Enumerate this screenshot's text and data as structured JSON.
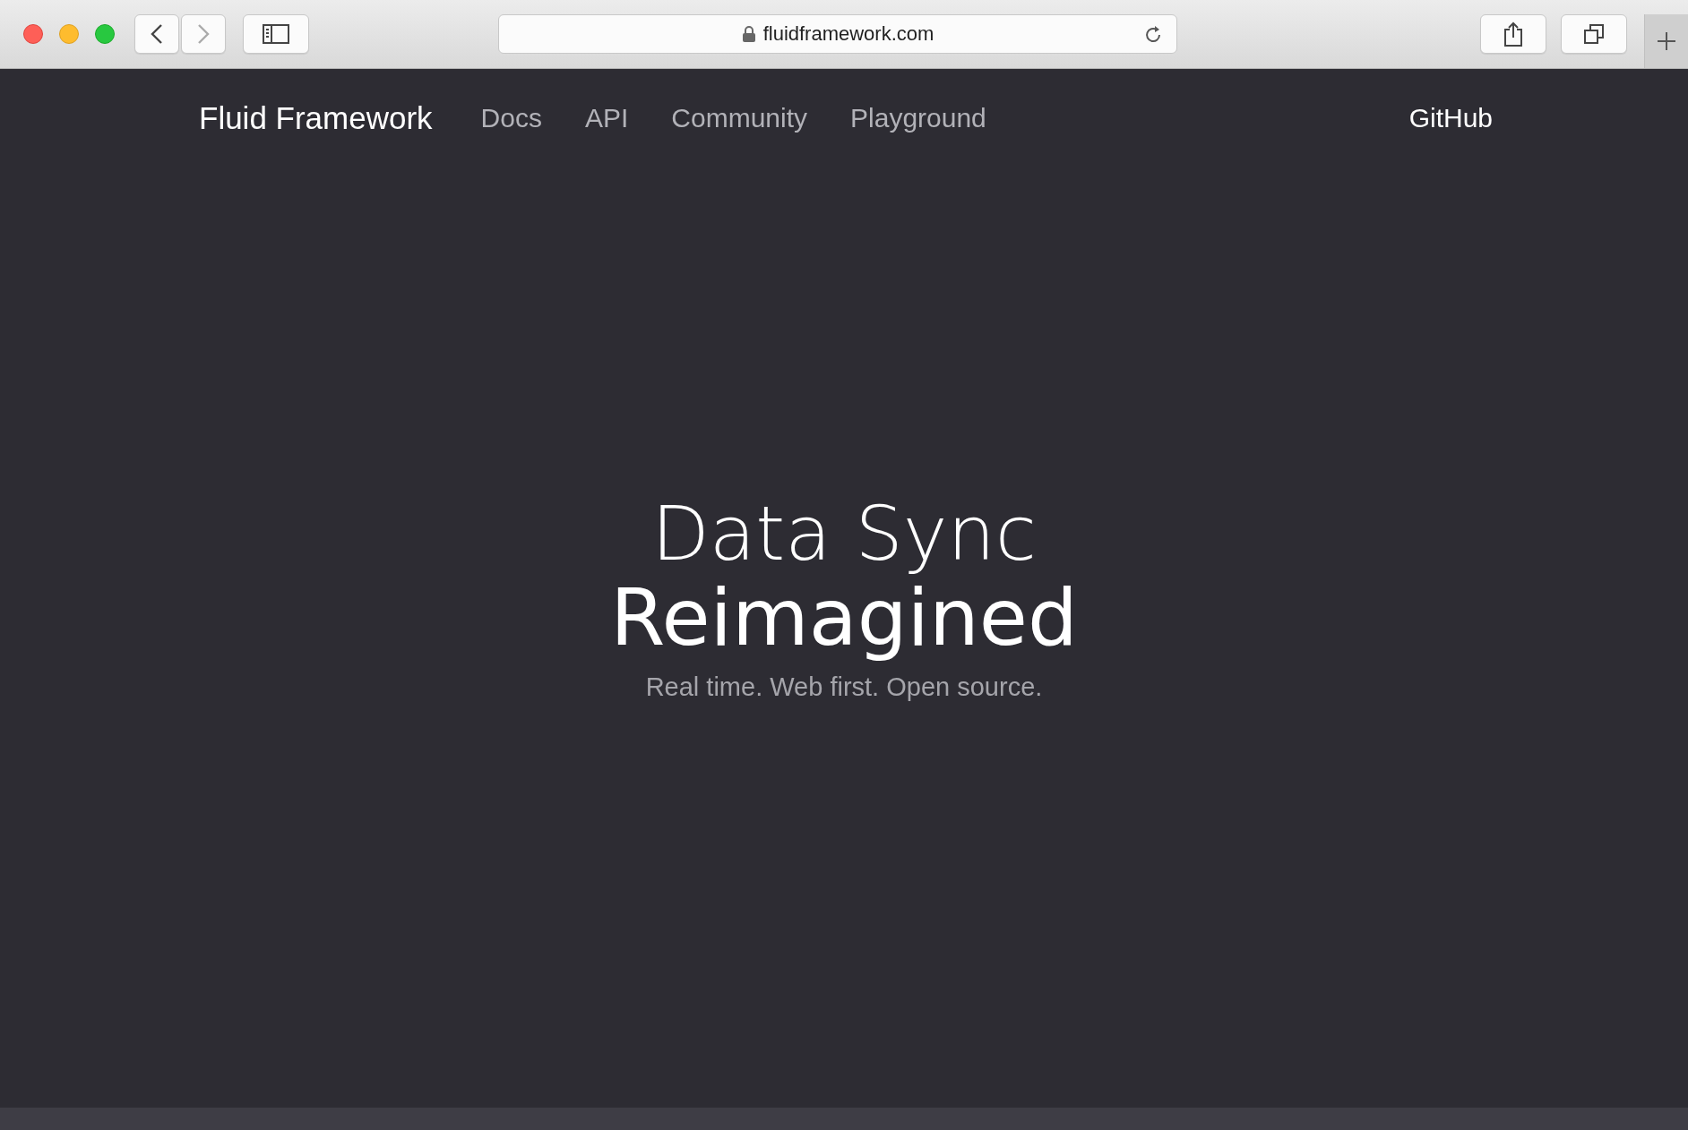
{
  "browser": {
    "url": "fluidframework.com",
    "back": {
      "disabled": false
    },
    "forward": {
      "disabled": true
    }
  },
  "nav": {
    "brand": "Fluid Framework",
    "links": [
      "Docs",
      "API",
      "Community",
      "Playground"
    ],
    "github": "GitHub"
  },
  "hero": {
    "title": "Data Sync",
    "headline": "Reimagined",
    "tagline": "Real time. Web first. Open source."
  }
}
